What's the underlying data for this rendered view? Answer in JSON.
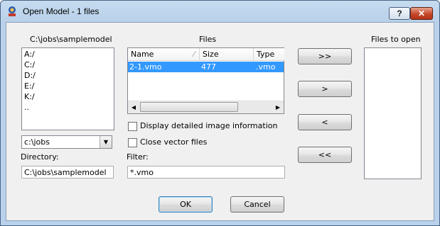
{
  "window": {
    "title": "Open Model - 1 files",
    "help_label": "?",
    "close_label": "✕"
  },
  "left": {
    "path_label": "C:\\jobs\\samplemodel",
    "drives": [
      "A:/",
      "C:/",
      "D:/",
      "E:/",
      "K:/",
      ".."
    ],
    "combo_value": "c:\\jobs",
    "directory_label": "Directory:",
    "directory_value": "C:\\jobs\\samplemodel"
  },
  "files": {
    "label": "Files",
    "columns": [
      "Name",
      "Size",
      "Type"
    ],
    "rows": [
      {
        "name": "2-1.vmo",
        "size": "477",
        "type": ".vmo"
      }
    ],
    "detailed_label": "Display detailed image information",
    "close_vector_label": "Close vector files",
    "filter_label": "Filter:",
    "filter_value": "*.vmo"
  },
  "transfer": {
    "add_all": ">>",
    "add": ">",
    "remove": "<",
    "remove_all": "<<"
  },
  "open": {
    "label": "Files to open"
  },
  "footer": {
    "ok": "OK",
    "cancel": "Cancel"
  }
}
